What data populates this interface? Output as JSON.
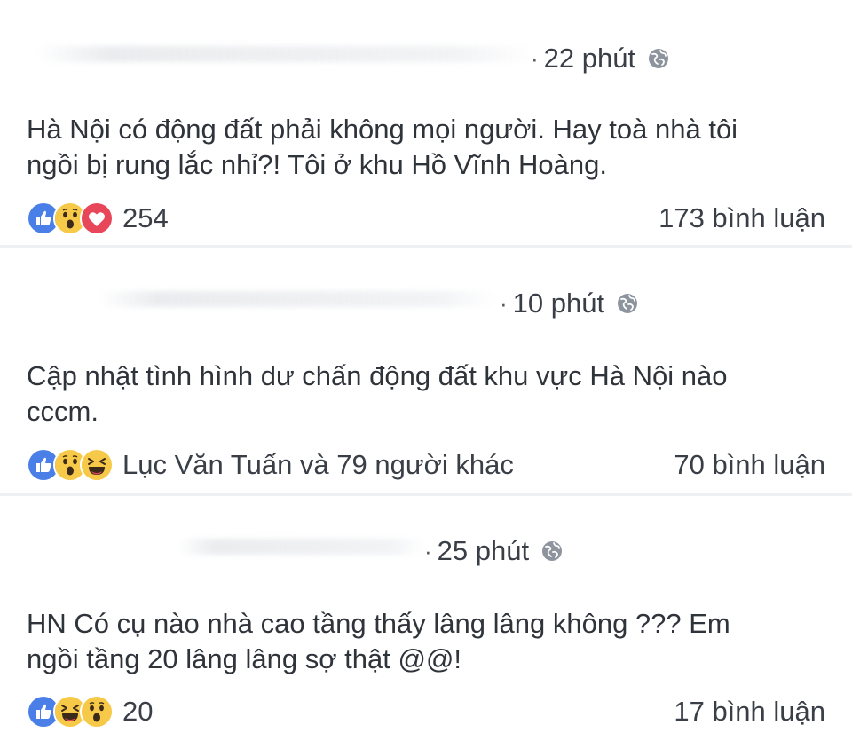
{
  "posts": [
    {
      "time": "22 phút",
      "text_line1": "Hà Nội có động đất phải không mọi người. Hay toà nhà tôi",
      "text_line2": "ngồi bị rung lắc nhỉ?!  Tôi ở khu Hồ Vĩnh Hoàng.",
      "reactions": [
        "like-icon",
        "wow-icon",
        "love-icon"
      ],
      "reaction_summary": "254",
      "comments": "173 bình luận"
    },
    {
      "time": "10 phút",
      "text_line1": "Cập nhật tình hình dư chấn động đất khu vực Hà Nội nào",
      "text_line2": "cccm.",
      "reactions": [
        "like-icon",
        "wow-icon",
        "haha-icon"
      ],
      "reaction_summary": "Lục Văn Tuấn và 79 người khác",
      "comments": "70 bình luận"
    },
    {
      "time": "25 phút",
      "text_line1": "HN Có cụ nào nhà cao tầng thấy lâng lâng không ??? Em",
      "text_line2": "ngồi tầng 20 lâng lâng sợ thật @@!",
      "reactions": [
        "like-icon",
        "haha-icon",
        "wow-icon"
      ],
      "reaction_summary": "20",
      "comments": "17 bình luận"
    }
  ],
  "colors": {
    "like": "#4a7fe8",
    "wow": "#f7c948",
    "love": "#e8475a",
    "text": "#2f333a",
    "meta": "#3a3f47"
  },
  "privacy_icon": "globe-icon"
}
